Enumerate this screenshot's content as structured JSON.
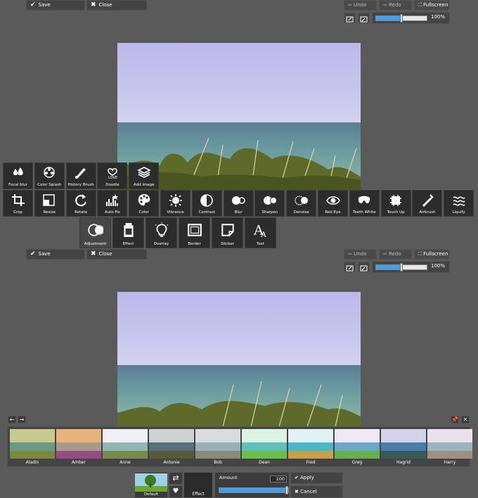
{
  "top_panel": {
    "save_label": "Save",
    "close_label": "Close",
    "undo_label": "Undo",
    "redo_label": "Redo",
    "fullscreen_label": "Fullscreen",
    "zoom_value": 0.5,
    "zoom_label": "100%"
  },
  "tools_row1": [
    {
      "label": "Focal blur",
      "icon": "focal-blur-icon"
    },
    {
      "label": "Color Splash",
      "icon": "color-splash-icon"
    },
    {
      "label": "History Brush",
      "icon": "history-brush-icon"
    },
    {
      "label": "Doodle",
      "icon": "doodle-icon"
    },
    {
      "label": "Add image",
      "icon": "add-image-icon"
    }
  ],
  "tools_row2": [
    {
      "label": "Crop",
      "icon": "crop-icon"
    },
    {
      "label": "Resize",
      "icon": "resize-icon"
    },
    {
      "label": "Rotate",
      "icon": "rotate-icon"
    },
    {
      "label": "Auto Fix",
      "icon": "auto-fix-icon"
    },
    {
      "label": "Color",
      "icon": "palette-icon"
    },
    {
      "label": "Vibrance",
      "icon": "sun-icon"
    },
    {
      "label": "Contrast",
      "icon": "contrast-icon"
    },
    {
      "label": "Blur",
      "icon": "blur-icon"
    },
    {
      "label": "Sharpen",
      "icon": "sharpen-icon"
    },
    {
      "label": "Denoise",
      "icon": "denoise-icon"
    },
    {
      "label": "Red Eye",
      "icon": "eye-icon"
    },
    {
      "label": "Teeth White",
      "icon": "teeth-icon"
    },
    {
      "label": "Touch Up",
      "icon": "touch-up-icon"
    },
    {
      "label": "Airbrush",
      "icon": "airbrush-icon"
    },
    {
      "label": "Liquify",
      "icon": "liquify-icon"
    }
  ],
  "tools_row3": [
    {
      "label": "Adjustment",
      "icon": "adjustment-icon"
    },
    {
      "label": "Effect",
      "icon": "effect-icon"
    },
    {
      "label": "Overlay",
      "icon": "overlay-icon"
    },
    {
      "label": "Border",
      "icon": "border-icon"
    },
    {
      "label": "Sticker",
      "icon": "sticker-icon"
    },
    {
      "label": "Text",
      "icon": "text-icon"
    }
  ],
  "bottom_panel": {
    "save_label": "Save",
    "close_label": "Close",
    "undo_label": "Undo",
    "redo_label": "Redo",
    "fullscreen_label": "Fullscreen",
    "zoom_value": 0.5,
    "zoom_label": "100%"
  },
  "filters": [
    {
      "name": "Aladin",
      "sky": "#c7c98f",
      "water": "#6a9a86",
      "ground": "#7a8a3a"
    },
    {
      "name": "Amber",
      "sky": "#e9b27a",
      "water": "#a79a8a",
      "ground": "#9a4a8a"
    },
    {
      "name": "Anne",
      "sky": "#f2eef5",
      "water": "#8fb7b5",
      "ground": "#7a8a4a"
    },
    {
      "name": "Antonie",
      "sky": "#cfd2d2",
      "water": "#55707a",
      "ground": "#5a5a3a"
    },
    {
      "name": "Bob",
      "sky": "#d8dce0",
      "water": "#9ab0b8",
      "ground": "#8a8a7a"
    },
    {
      "name": "Dean",
      "sky": "#dbf5e2",
      "water": "#5ec0b8",
      "ground": "#6ac04a"
    },
    {
      "name": "Fred",
      "sky": "#dff3f6",
      "water": "#4ab8c8",
      "ground": "#c8a04a"
    },
    {
      "name": "Greg",
      "sky": "#f2e9f6",
      "water": "#6aa8c8",
      "ground": "#6ab04a"
    },
    {
      "name": "Hagrid",
      "sky": "#d2d2ea",
      "water": "#4a7ea8",
      "ground": "#3a5a5a"
    },
    {
      "name": "Harry",
      "sky": "#ece0ee",
      "water": "#9ab4c0",
      "ground": "#a09080"
    }
  ],
  "adjust_panel": {
    "default_label": "Default",
    "effect_label": "Effect",
    "amount_label": "Amount",
    "amount_value": "100",
    "amount_fraction": 1.0,
    "apply_label": "Apply",
    "cancel_label": "Cancel"
  }
}
